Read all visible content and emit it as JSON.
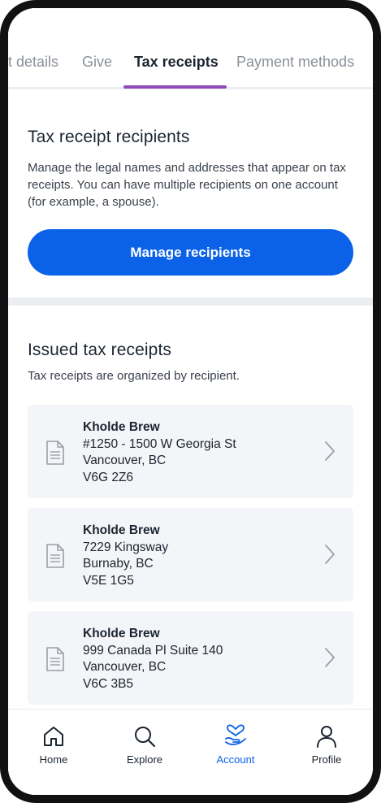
{
  "tabs": [
    {
      "label": "t details",
      "active": false
    },
    {
      "label": "Give",
      "active": false
    },
    {
      "label": "Tax receipts",
      "active": true
    },
    {
      "label": "Payment methods",
      "active": false
    }
  ],
  "recipients_section": {
    "title": "Tax receipt recipients",
    "description": "Manage the legal names and addresses that appear on tax receipts. You can have multiple recipients on one account (for example, a spouse).",
    "button_label": "Manage recipients"
  },
  "issued_section": {
    "title": "Issued tax receipts",
    "subtitle": "Tax receipts are organized by recipient.",
    "receipts": [
      {
        "name": "Kholde Brew",
        "address": "#1250 - 1500 W Georgia St",
        "city": "Vancouver, BC",
        "postal": "V6G 2Z6",
        "icon": "document-icon"
      },
      {
        "name": "Kholde Brew",
        "address": "7229 Kingsway",
        "city": "Burnaby, BC",
        "postal": "V5E 1G5",
        "icon": "document-icon"
      },
      {
        "name": "Kholde Brew",
        "address": "999 Canada Pl Suite 140",
        "city": "Vancouver, BC",
        "postal": "V6C 3B5",
        "icon": "document-icon"
      }
    ]
  },
  "bottom_nav": [
    {
      "label": "Home",
      "icon": "home-icon",
      "active": false
    },
    {
      "label": "Explore",
      "icon": "search-icon",
      "active": false
    },
    {
      "label": "Account",
      "icon": "heart-hand-icon",
      "active": true
    },
    {
      "label": "Profile",
      "icon": "person-icon",
      "active": false
    }
  ],
  "colors": {
    "primary": "#0b62e8",
    "tab_underline": "#8e4cb8",
    "text_dark": "#1c2530",
    "text_muted": "#8b9098",
    "card_bg": "#f3f5f9"
  }
}
